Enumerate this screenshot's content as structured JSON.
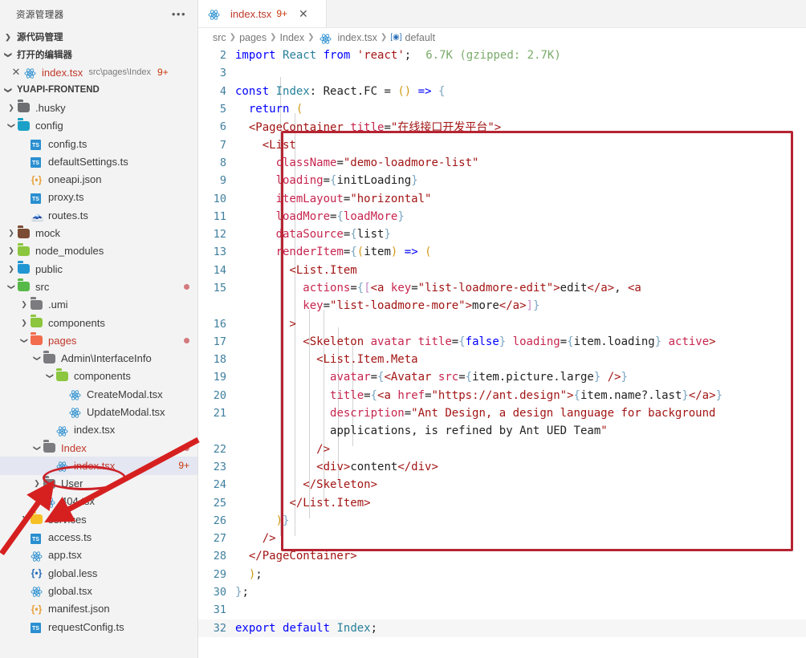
{
  "sidebar": {
    "header": {
      "title": "资源管理器",
      "more_icon": "ellipsis-icon"
    },
    "sections": [
      {
        "label": "源代码管理",
        "state": "collapsed"
      },
      {
        "label": "打开的编辑器",
        "state": "expanded"
      },
      {
        "label": "YUAPI-FRONTEND",
        "state": "expanded"
      }
    ],
    "open_editors": [
      {
        "name": "index.tsx",
        "path": "src\\pages\\Index",
        "badge": "9+",
        "icon": "react-icon",
        "close_icon": "close-icon"
      }
    ],
    "tree": [
      {
        "label": ".husky",
        "indent": 1,
        "type": "folder",
        "chev": "collapsed",
        "color": "grey",
        "icon": "folder-husky-icon"
      },
      {
        "label": "config",
        "indent": 1,
        "type": "folder",
        "chev": "expanded",
        "color": "teal",
        "icon": "folder-config-icon"
      },
      {
        "label": "config.ts",
        "indent": 2,
        "type": "ts",
        "icon": "typescript-icon"
      },
      {
        "label": "defaultSettings.ts",
        "indent": 2,
        "type": "ts",
        "icon": "typescript-icon"
      },
      {
        "label": "oneapi.json",
        "indent": 2,
        "type": "json",
        "icon": "json-icon"
      },
      {
        "label": "proxy.ts",
        "indent": 2,
        "type": "ts",
        "icon": "typescript-icon"
      },
      {
        "label": "routes.ts",
        "indent": 2,
        "type": "routes",
        "icon": "routes-icon"
      },
      {
        "label": "mock",
        "indent": 1,
        "type": "folder",
        "chev": "collapsed",
        "color": "brown",
        "icon": "folder-mock-icon"
      },
      {
        "label": "node_modules",
        "indent": 1,
        "type": "folder",
        "chev": "collapsed",
        "color": "green",
        "icon": "folder-node-modules-icon"
      },
      {
        "label": "public",
        "indent": 1,
        "type": "folder",
        "chev": "collapsed",
        "color": "blue",
        "icon": "folder-public-icon"
      },
      {
        "label": "src",
        "indent": 1,
        "type": "folder",
        "chev": "expanded",
        "color": "lgreen",
        "icon": "folder-src-icon",
        "dirty": true
      },
      {
        "label": ".umi",
        "indent": 2,
        "type": "folder",
        "chev": "collapsed",
        "color": "dgrey",
        "icon": "folder-umi-icon"
      },
      {
        "label": "components",
        "indent": 2,
        "type": "folder",
        "chev": "collapsed",
        "color": "green",
        "icon": "folder-components-icon"
      },
      {
        "label": "pages",
        "indent": 2,
        "type": "folder",
        "chev": "expanded",
        "color": "orange",
        "icon": "folder-pages-icon",
        "dirty": true,
        "modified": true
      },
      {
        "label": "Admin\\InterfaceInfo",
        "indent": 3,
        "type": "folder",
        "chev": "expanded",
        "color": "dgrey",
        "icon": "folder-admin-icon"
      },
      {
        "label": "components",
        "indent": 4,
        "type": "folder",
        "chev": "expanded",
        "color": "green",
        "icon": "folder-components-icon"
      },
      {
        "label": "CreateModal.tsx",
        "indent": 5,
        "type": "react",
        "icon": "react-icon"
      },
      {
        "label": "UpdateModal.tsx",
        "indent": 5,
        "type": "react",
        "icon": "react-icon"
      },
      {
        "label": "index.tsx",
        "indent": 4,
        "type": "react",
        "icon": "react-icon"
      },
      {
        "label": "Index",
        "indent": 3,
        "type": "folder",
        "chev": "expanded",
        "color": "dgrey",
        "icon": "folder-index-icon",
        "dirty": true,
        "modified": true
      },
      {
        "label": "index.tsx",
        "indent": 4,
        "type": "react",
        "icon": "react-icon",
        "badge": "9+",
        "selected": true,
        "modified": true
      },
      {
        "label": "User",
        "indent": 3,
        "type": "folder",
        "chev": "collapsed",
        "color": "dgrey",
        "icon": "folder-user-icon"
      },
      {
        "label": "404.tsx",
        "indent": 3,
        "type": "react",
        "icon": "react-icon"
      },
      {
        "label": "services",
        "indent": 2,
        "type": "folder",
        "chev": "collapsed",
        "color": "yellow",
        "icon": "folder-services-icon"
      },
      {
        "label": "access.ts",
        "indent": 2,
        "type": "ts",
        "icon": "typescript-icon"
      },
      {
        "label": "app.tsx",
        "indent": 2,
        "type": "react",
        "icon": "react-icon"
      },
      {
        "label": "global.less",
        "indent": 2,
        "type": "json",
        "icon": "less-icon",
        "jsonColor": "blue"
      },
      {
        "label": "global.tsx",
        "indent": 2,
        "type": "react",
        "icon": "react-icon"
      },
      {
        "label": "manifest.json",
        "indent": 2,
        "type": "json",
        "icon": "json-icon"
      },
      {
        "label": "requestConfig.ts",
        "indent": 2,
        "type": "ts",
        "icon": "typescript-icon"
      }
    ]
  },
  "editor": {
    "tab": {
      "label": "index.tsx",
      "badge": "9+",
      "close_icon": "close-icon",
      "file_icon": "react-icon"
    },
    "breadcrumb": [
      "src",
      "pages",
      "Index",
      "index.tsx",
      "default"
    ],
    "breadcrumb_symbol_icon": "symbol-namespace-icon",
    "inline_hint": "6.7K (gzipped: 2.7K)",
    "first_line_number": 2,
    "lines": [
      {
        "n": 2,
        "text": "import React from 'react';"
      },
      {
        "n": 3,
        "text": ""
      },
      {
        "n": 4,
        "text": "const Index: React.FC = () => {"
      },
      {
        "n": 5,
        "text": "  return ("
      },
      {
        "n": 6,
        "text": "  <PageContainer title=\"在线接口开发平台\">"
      },
      {
        "n": 7,
        "text": "    <List"
      },
      {
        "n": 8,
        "text": "      className=\"demo-loadmore-list\""
      },
      {
        "n": 9,
        "text": "      loading={initLoading}"
      },
      {
        "n": 10,
        "text": "      itemLayout=\"horizontal\""
      },
      {
        "n": 11,
        "text": "      loadMore={loadMore}"
      },
      {
        "n": 12,
        "text": "      dataSource={list}"
      },
      {
        "n": 13,
        "text": "      renderItem={(item) => ("
      },
      {
        "n": 14,
        "text": "        <List.Item"
      },
      {
        "n": 15,
        "text": "          actions={[<a key=\"list-loadmore-edit\">edit</a>, <a"
      },
      {
        "n": null,
        "text": "          key=\"list-loadmore-more\">more</a>]}"
      },
      {
        "n": 16,
        "text": "        >"
      },
      {
        "n": 17,
        "text": "          <Skeleton avatar title={false} loading={item.loading} active>"
      },
      {
        "n": 18,
        "text": "            <List.Item.Meta"
      },
      {
        "n": 19,
        "text": "              avatar={<Avatar src={item.picture.large} />}"
      },
      {
        "n": 20,
        "text": "              title={<a href=\"https://ant.design\">{item.name?.last}</a>}"
      },
      {
        "n": 21,
        "text": "              description=\"Ant Design, a design language for background"
      },
      {
        "n": null,
        "text": "              applications, is refined by Ant UED Team\""
      },
      {
        "n": 22,
        "text": "            />"
      },
      {
        "n": 23,
        "text": "            <div>content</div>"
      },
      {
        "n": 24,
        "text": "          </Skeleton>"
      },
      {
        "n": 25,
        "text": "        </List.Item>"
      },
      {
        "n": 26,
        "text": "      )}"
      },
      {
        "n": 27,
        "text": "    />"
      },
      {
        "n": 28,
        "text": "  </PageContainer>"
      },
      {
        "n": 29,
        "text": "  );"
      },
      {
        "n": 30,
        "text": "};"
      },
      {
        "n": 31,
        "text": ""
      },
      {
        "n": 32,
        "text": "export default Index;"
      }
    ]
  },
  "annotations": {
    "rect_color": "#b52432",
    "ellipse_color": "#cc2229",
    "arrow_color": "#d62020",
    "arrow_count": 2
  }
}
